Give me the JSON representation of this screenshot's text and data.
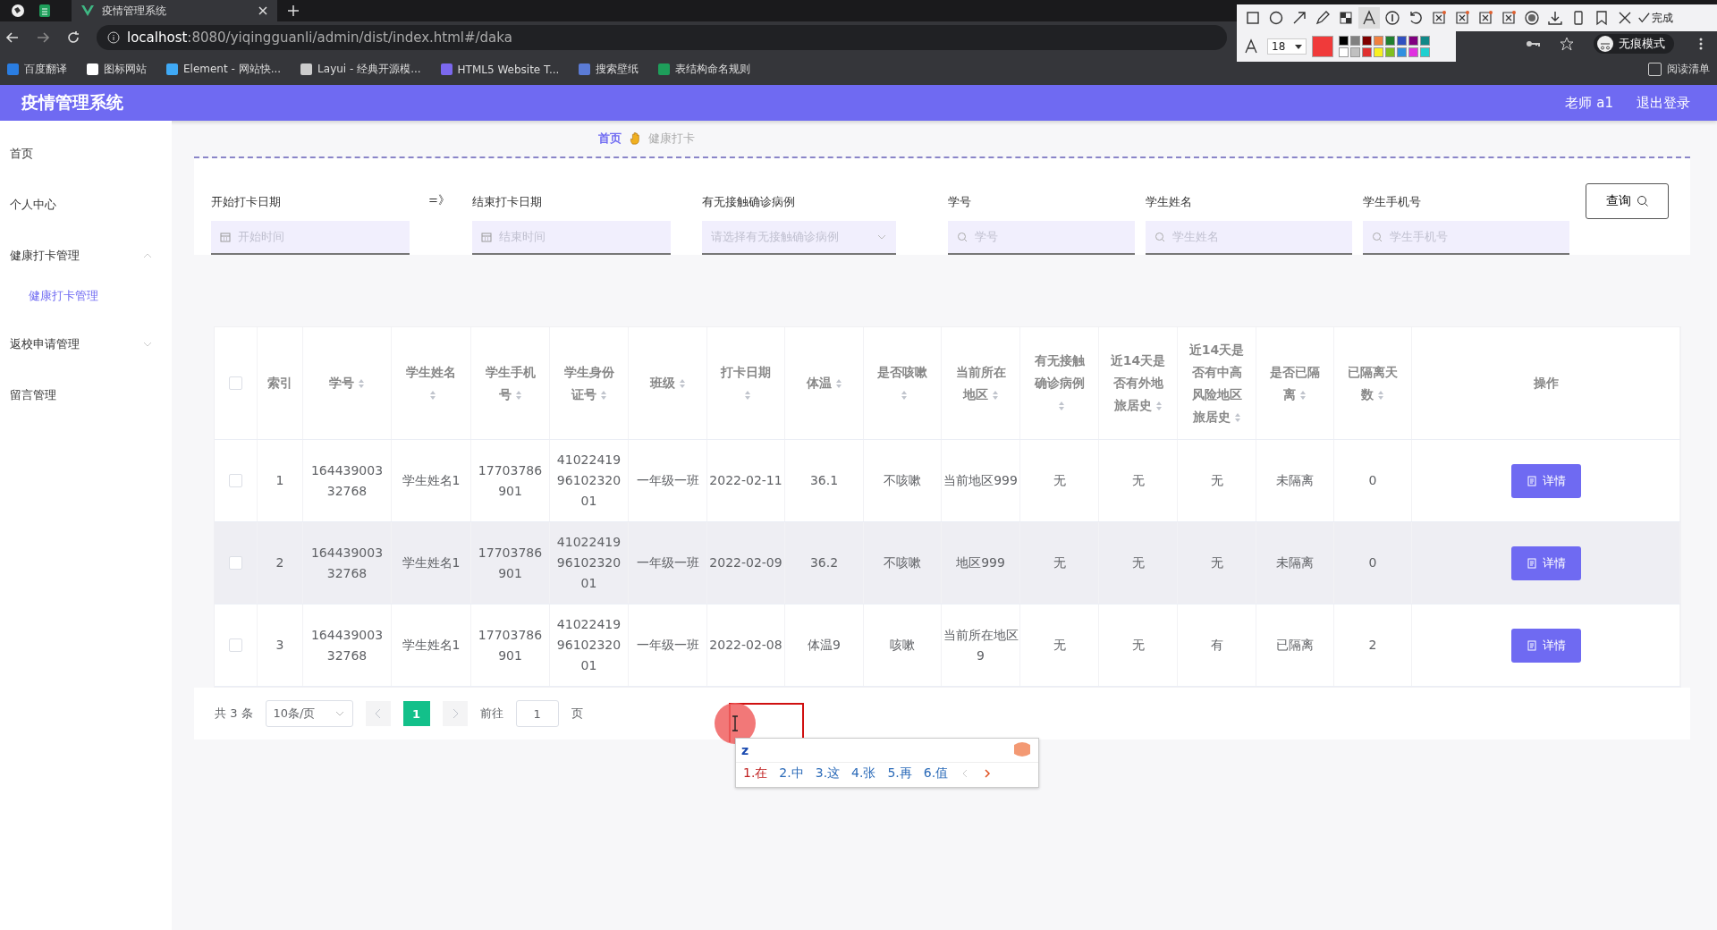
{
  "browser": {
    "tabs": [
      {
        "title": "疫情管理系统",
        "selected": true
      }
    ],
    "url_host": "localhost",
    "url_rest": ":8080/yiqingguanli/admin/dist/index.html#/daka",
    "bookmarks": [
      "百度翻译",
      "图标网站",
      "Element - 网站快...",
      "Layui - 经典开源模...",
      "HTML5 Website T...",
      "搜索壁纸",
      "表结构命名规则"
    ],
    "profile": "无痕模式",
    "reading_list": "阅读清单"
  },
  "capture_toolbar": {
    "done": "完成",
    "font_size": "18",
    "palette": [
      {
        "color": "#000000"
      },
      {
        "color": "#808080"
      },
      {
        "color": "#800000"
      },
      {
        "color": "#f08040"
      },
      {
        "color": "#208030"
      },
      {
        "color": "#3050c0"
      },
      {
        "color": "#800080"
      },
      {
        "color": "#108888"
      },
      {
        "color": "#ffffff"
      },
      {
        "color": "#c0c0c0"
      },
      {
        "color": "#e03030"
      },
      {
        "color": "#f8f020"
      },
      {
        "color": "#80c020"
      },
      {
        "color": "#3090e0"
      },
      {
        "color": "#e030e0"
      },
      {
        "color": "#20d0d0"
      }
    ]
  },
  "header": {
    "title": "疫情管理系统",
    "user": "老师 a1",
    "logout": "退出登录"
  },
  "sidebar": {
    "items": [
      {
        "label": "首页",
        "selected": false
      },
      {
        "label": "个人中心",
        "selected": false
      },
      {
        "label": "健康打卡管理",
        "selected": false,
        "expanded": true,
        "children": [
          {
            "label": "健康打卡管理",
            "selected": true
          }
        ]
      },
      {
        "label": "返校申请管理",
        "selected": false,
        "expanded": false
      },
      {
        "label": "留言管理",
        "selected": false
      }
    ]
  },
  "breadcrumb": [
    "首页",
    "健康打卡"
  ],
  "filters": [
    {
      "label": "开始打卡日期",
      "placeholder": "开始时间",
      "kind": "date"
    },
    {
      "label": "结束打卡日期",
      "placeholder": "结束时间",
      "kind": "date"
    },
    {
      "label": "有无接触确诊病例",
      "placeholder": "请选择有无接触确诊病例",
      "kind": "select"
    },
    {
      "label": "学号",
      "placeholder": "学号",
      "kind": "text"
    },
    {
      "label": "学生姓名",
      "placeholder": "学生姓名",
      "kind": "text"
    },
    {
      "label": "学生手机号",
      "placeholder": "学生手机号",
      "kind": "text"
    }
  ],
  "date_separator": "=》",
  "query_button": "查询",
  "table": {
    "all_checked": false,
    "columns": [
      {
        "label": "索引",
        "sortable": false
      },
      {
        "label": "学号",
        "sortable": true
      },
      {
        "label": "学生姓名",
        "sortable": true
      },
      {
        "label": "学生手机号",
        "sortable": true
      },
      {
        "label": "学生身份证号",
        "sortable": true
      },
      {
        "label": "班级",
        "sortable": true
      },
      {
        "label": "打卡日期",
        "sortable": true
      },
      {
        "label": "体温",
        "sortable": true
      },
      {
        "label": "是否咳嗽",
        "sortable": true
      },
      {
        "label": "当前所在地区",
        "sortable": true
      },
      {
        "label": "有无接触确诊病例",
        "sortable": true
      },
      {
        "label": "近14天是否有外地旅居史",
        "sortable": true
      },
      {
        "label": "近14天是否有中高风险地区旅居史",
        "sortable": true
      },
      {
        "label": "是否已隔离",
        "sortable": true
      },
      {
        "label": "已隔离天数",
        "sortable": true
      },
      {
        "label": "操作",
        "sortable": false
      }
    ],
    "rows": [
      {
        "checked": false,
        "hovered": false,
        "action": "详情",
        "cells": [
          "1",
          "16443900332768",
          "学生姓名1",
          "17703786901",
          "410224199610232001",
          "一年级一班",
          "2022-02-11",
          "36.1",
          "不咳嗽",
          "当前地区999",
          "无",
          "无",
          "无",
          "未隔离",
          "0"
        ]
      },
      {
        "checked": false,
        "hovered": true,
        "action": "详情",
        "cells": [
          "2",
          "16443900332768",
          "学生姓名1",
          "17703786901",
          "410224199610232001",
          "一年级一班",
          "2022-02-09",
          "36.2",
          "不咳嗽",
          "地区999",
          "无",
          "无",
          "无",
          "未隔离",
          "0"
        ]
      },
      {
        "checked": false,
        "hovered": false,
        "action": "详情",
        "cells": [
          "3",
          "16443900332768",
          "学生姓名1",
          "17703786901",
          "410224199610232001",
          "一年级一班",
          "2022-02-08",
          "体温9",
          "咳嗽",
          "当前所在地区9",
          "无",
          "无",
          "有",
          "已隔离",
          "2"
        ]
      }
    ]
  },
  "pagination": {
    "total": "共 3 条",
    "page_size": "10条/页",
    "pages": [
      {
        "label": "1",
        "selected": true
      }
    ],
    "goto_label": "前往",
    "goto_value": "1",
    "goto_suffix": "页"
  },
  "ime": {
    "input": "z",
    "candidates": [
      "1.在",
      "2.中",
      "3.这",
      "4.张",
      "5.再",
      "6.值"
    ]
  }
}
